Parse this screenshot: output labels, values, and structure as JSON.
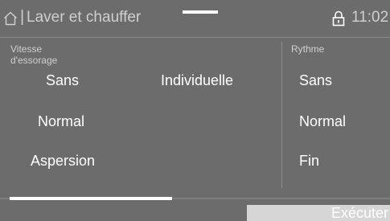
{
  "header": {
    "separator": "|",
    "title": "Laver et chauffer",
    "time": "11:02",
    "home_icon": "home-icon",
    "lock_icon": "lock-icon"
  },
  "spin": {
    "label_line1": "Vitesse",
    "label_line2": "d'essorage",
    "options": [
      "Sans",
      "Normal",
      "Aspersion"
    ],
    "individual": "Individuelle"
  },
  "rhythm": {
    "label": "Rythme",
    "options": [
      "Sans",
      "Normal",
      "Fin"
    ]
  },
  "footer": {
    "execute_label": "Exécuter"
  },
  "colors": {
    "background": "#6c6c6c",
    "text": "#ffffff",
    "muted_text": "#cfcfcf",
    "button": "#d6d6d6"
  }
}
